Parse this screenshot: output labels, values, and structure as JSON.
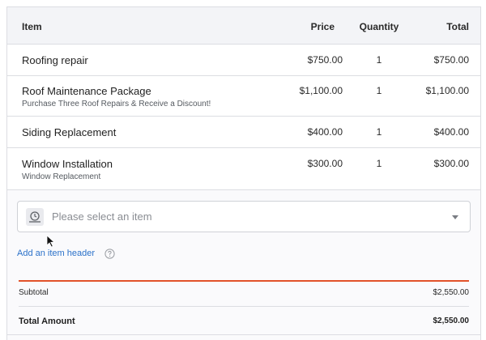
{
  "table": {
    "headers": {
      "item": "Item",
      "price": "Price",
      "quantity": "Quantity",
      "total": "Total"
    },
    "rows": [
      {
        "name": "Roofing repair",
        "description": "",
        "price": "$750.00",
        "quantity": "1",
        "total": "$750.00"
      },
      {
        "name": "Roof Maintenance Package",
        "description": "Purchase Three Roof Repairs & Receive a Discount!",
        "price": "$1,100.00",
        "quantity": "1",
        "total": "$1,100.00"
      },
      {
        "name": "Siding Replacement",
        "description": "",
        "price": "$400.00",
        "quantity": "1",
        "total": "$400.00"
      },
      {
        "name": "Window Installation",
        "description": "Window Replacement",
        "price": "$300.00",
        "quantity": "1",
        "total": "$300.00"
      }
    ]
  },
  "item_select": {
    "placeholder": "Please select an item",
    "icon": "product-icon"
  },
  "add_header": {
    "label": "Add an item header",
    "icon": "help-icon"
  },
  "summary": {
    "subtotal_label": "Subtotal",
    "subtotal_value": "$2,550.00",
    "total_label": "Total Amount",
    "total_value": "$2,550.00"
  },
  "colors": {
    "accent": "#e2522a",
    "link": "#2b71c9",
    "border": "#dcdde2",
    "header_bg": "#f3f4f7"
  }
}
